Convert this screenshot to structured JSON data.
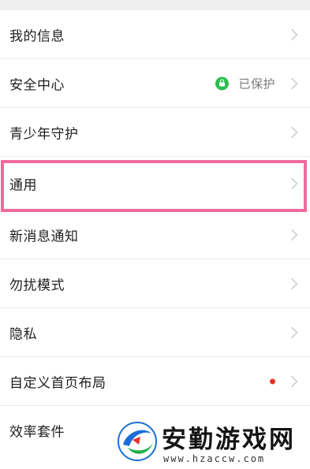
{
  "settings": {
    "items": [
      {
        "label": "我的信息"
      },
      {
        "label": "安全中心",
        "status": "已保护"
      },
      {
        "label": "青少年守护"
      },
      {
        "label": "通用"
      },
      {
        "label": "新消息通知"
      },
      {
        "label": "勿扰模式"
      },
      {
        "label": "隐私"
      },
      {
        "label": "自定义首页布局"
      },
      {
        "label": "效率套件"
      }
    ]
  },
  "colors": {
    "highlight_border": "#ef6b9d",
    "protected_icon": "#2dbd4e",
    "badge_dot": "#e5332a"
  },
  "watermark": {
    "title": "安勤游戏网",
    "url": "www.hzaccw.com"
  }
}
